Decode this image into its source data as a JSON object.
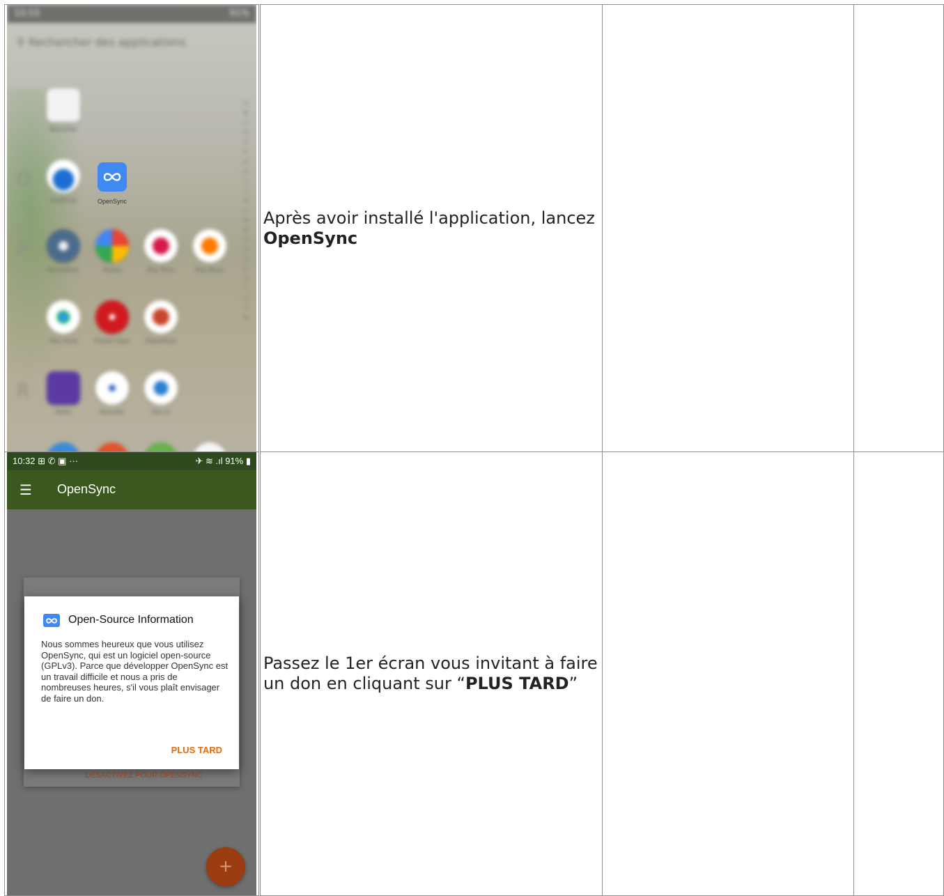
{
  "steps": [
    {
      "screenshot": {
        "status_time": "10:55",
        "status_right": "91%",
        "search_placeholder": "Rechercher des applications",
        "sections": [
          "O",
          "P",
          "R"
        ],
        "index_letters": [
          "A",
          "B",
          "C",
          "D",
          "E",
          "F",
          "G",
          "H",
          "I",
          "J",
          "K",
          "L",
          "M",
          "N",
          "O",
          "P",
          "Q",
          "R",
          "S",
          "T",
          "U",
          "V",
          "W"
        ],
        "apps": [
          {
            "label": "Nouvelles",
            "icon": "news-icon"
          },
          {
            "label": "OneDrive",
            "icon": "onedrive-icon"
          },
          {
            "label": "OpenSync",
            "icon": "opensync-icon"
          },
          {
            "label": "Paramètres",
            "icon": "settings-icon"
          },
          {
            "label": "Photos",
            "icon": "photos-icon"
          },
          {
            "label": "Play Films",
            "icon": "play-movies-icon"
          },
          {
            "label": "Play Music",
            "icon": "play-music-icon"
          },
          {
            "label": "Play Store",
            "icon": "play-store-icon"
          },
          {
            "label": "Pocket Casts",
            "icon": "pocket-casts-icon"
          },
          {
            "label": "PowerPoint",
            "icon": "powerpoint-icon"
          },
          {
            "label": "Radio",
            "icon": "radio-icon"
          },
          {
            "label": "Recorder",
            "icon": "recorder-icon"
          },
          {
            "label": "Run.rb",
            "icon": "run-icon"
          }
        ]
      },
      "text_before": "Après avoir installé l'application, lancez ",
      "text_bold": "OpenSync",
      "text_after": ""
    },
    {
      "screenshot": {
        "status_time": "10:32",
        "status_icons": "⊞ ✆ ▣ ···",
        "status_right": "✈ ≋ .ıl 91% ▮",
        "menu_icon": "☰",
        "app_title": "OpenSync",
        "dialog_title": "Open-Source Information",
        "dialog_body": "Nous sommes heureux que vous utilisez OpenSync, qui est un logiciel open-source (GPLv3). Parce que développer OpenSync est un travail difficile et nous a pris de nombreuses heures, s'il vous plaît envisager de faire un don.",
        "dialog_button": "PLUS TARD",
        "behind_button": "DÉSACTIVEZ POUR OPENSYNC",
        "fab_label": "+"
      },
      "text_before": "Passez le 1er écran vous invitant à faire un don en cliquant sur “",
      "text_bold": "PLUS TARD",
      "text_after": "”"
    }
  ]
}
